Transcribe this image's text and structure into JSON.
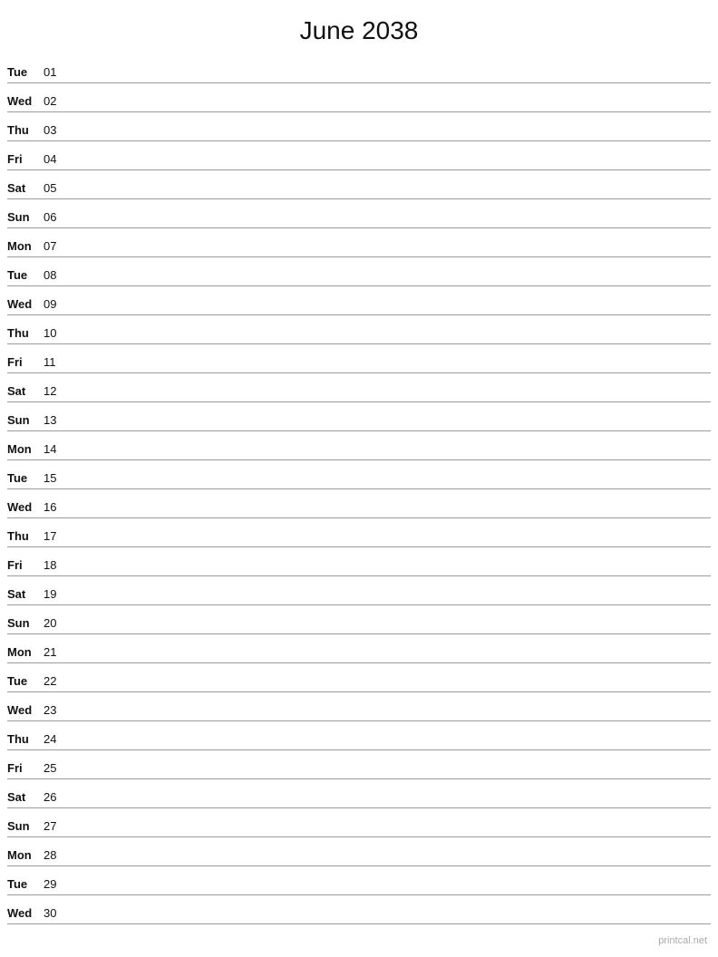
{
  "title": "June 2038",
  "days": [
    {
      "name": "Tue",
      "num": "01"
    },
    {
      "name": "Wed",
      "num": "02"
    },
    {
      "name": "Thu",
      "num": "03"
    },
    {
      "name": "Fri",
      "num": "04"
    },
    {
      "name": "Sat",
      "num": "05"
    },
    {
      "name": "Sun",
      "num": "06"
    },
    {
      "name": "Mon",
      "num": "07"
    },
    {
      "name": "Tue",
      "num": "08"
    },
    {
      "name": "Wed",
      "num": "09"
    },
    {
      "name": "Thu",
      "num": "10"
    },
    {
      "name": "Fri",
      "num": "11"
    },
    {
      "name": "Sat",
      "num": "12"
    },
    {
      "name": "Sun",
      "num": "13"
    },
    {
      "name": "Mon",
      "num": "14"
    },
    {
      "name": "Tue",
      "num": "15"
    },
    {
      "name": "Wed",
      "num": "16"
    },
    {
      "name": "Thu",
      "num": "17"
    },
    {
      "name": "Fri",
      "num": "18"
    },
    {
      "name": "Sat",
      "num": "19"
    },
    {
      "name": "Sun",
      "num": "20"
    },
    {
      "name": "Mon",
      "num": "21"
    },
    {
      "name": "Tue",
      "num": "22"
    },
    {
      "name": "Wed",
      "num": "23"
    },
    {
      "name": "Thu",
      "num": "24"
    },
    {
      "name": "Fri",
      "num": "25"
    },
    {
      "name": "Sat",
      "num": "26"
    },
    {
      "name": "Sun",
      "num": "27"
    },
    {
      "name": "Mon",
      "num": "28"
    },
    {
      "name": "Tue",
      "num": "29"
    },
    {
      "name": "Wed",
      "num": "30"
    }
  ],
  "watermark": "printcal.net"
}
